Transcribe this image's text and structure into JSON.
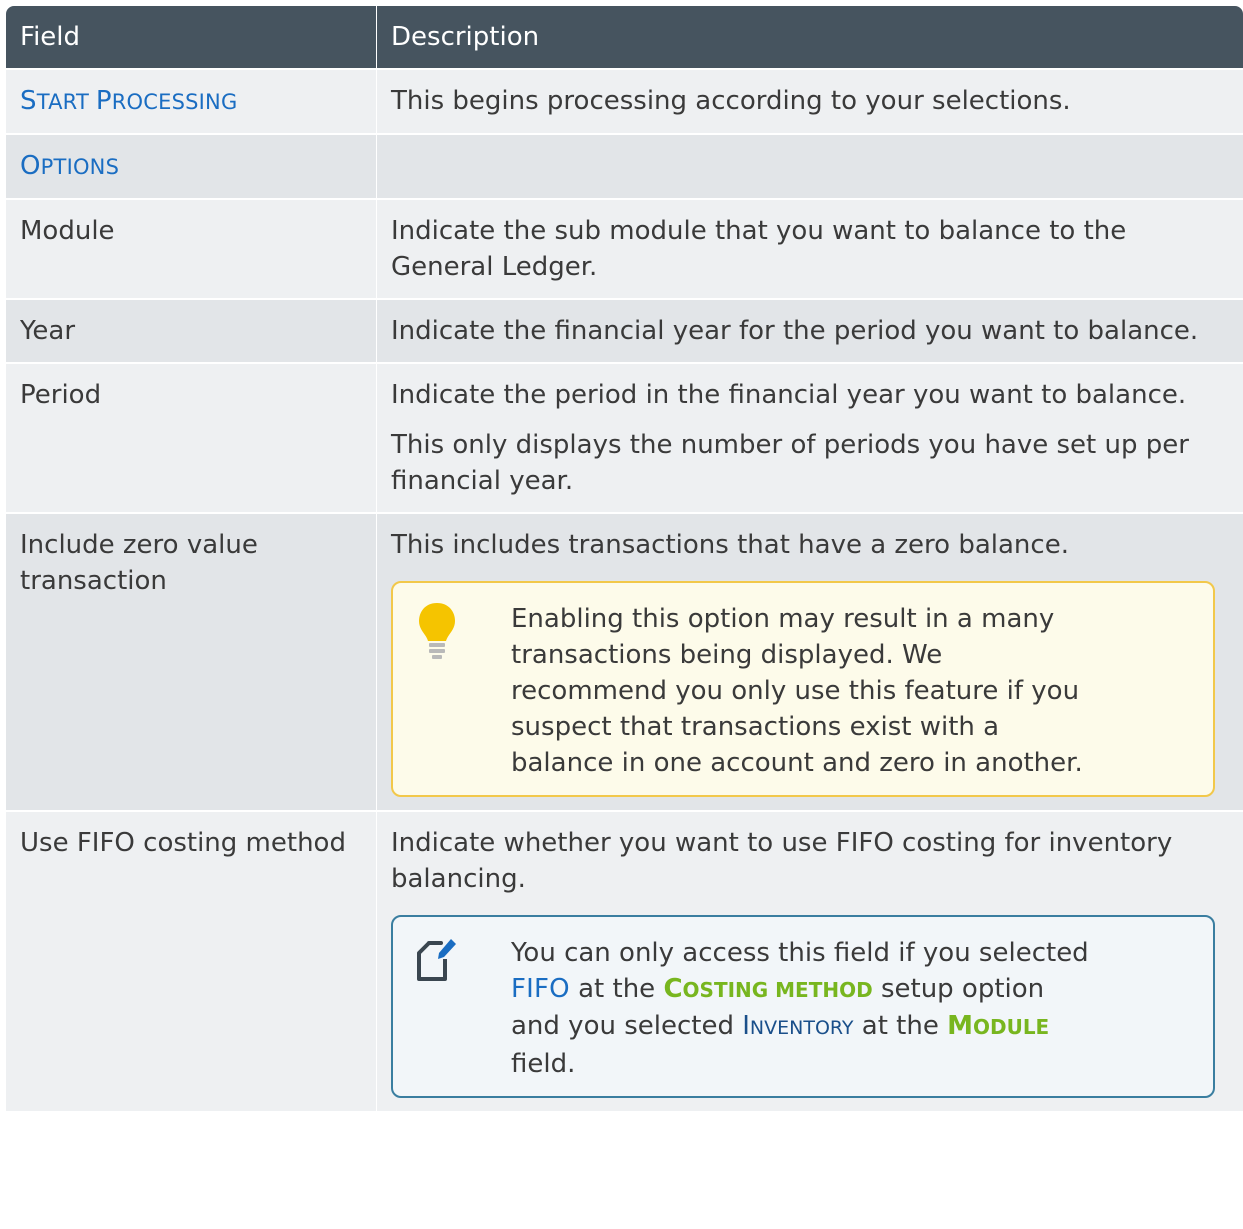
{
  "header": {
    "field": "Field",
    "description": "Description"
  },
  "rows": {
    "start_processing": {
      "field_first": "S",
      "field_rest": "TART ",
      "field_second_first": "P",
      "field_second_rest": "ROCESSING",
      "description": "This begins processing according to your selections."
    },
    "options": {
      "field_first": "O",
      "field_rest": "PTIONS"
    },
    "module": {
      "field": "Module",
      "description": "Indicate the sub module that you want to balance to the General Ledger."
    },
    "year": {
      "field": "Year",
      "description": "Indicate the financial year for the period you want to balance."
    },
    "period": {
      "field": "Period",
      "description_1": "Indicate the period in the financial year you want to balance.",
      "description_2": "This only displays the number of periods you have set up per financial year."
    },
    "include_zero": {
      "field": "Include zero value transaction",
      "description": "This includes transactions that have a zero balance.",
      "tip_icon": "lightbulb-icon",
      "tip": "Enabling this option may result in a many transactions being displayed. We recommend you only use this feature if you suspect that transactions exist with a balance in one account and zero in another."
    },
    "fifo": {
      "field": "Use FIFO costing method",
      "description": "Indicate whether you want to use FIFO costing for inventory balancing.",
      "note_icon": "note-pencil-icon",
      "note": {
        "t1": "You can only access this field if you selected ",
        "fifo": "FIFO",
        "t2": " at the ",
        "costing_big": "C",
        "costing_small": "OSTING METHOD",
        "t3": " setup option and you selected ",
        "inv_big": "I",
        "inv_small": "NVENTORY",
        "t4": " at the ",
        "module_big": "M",
        "module_small": "ODULE",
        "t5": " field."
      }
    }
  },
  "colors": {
    "header_bg": "#46545f",
    "link": "#1a6dc2",
    "accent_green": "#78b61f",
    "tip_border": "#f2c84a",
    "note_border": "#3a7ea0"
  }
}
